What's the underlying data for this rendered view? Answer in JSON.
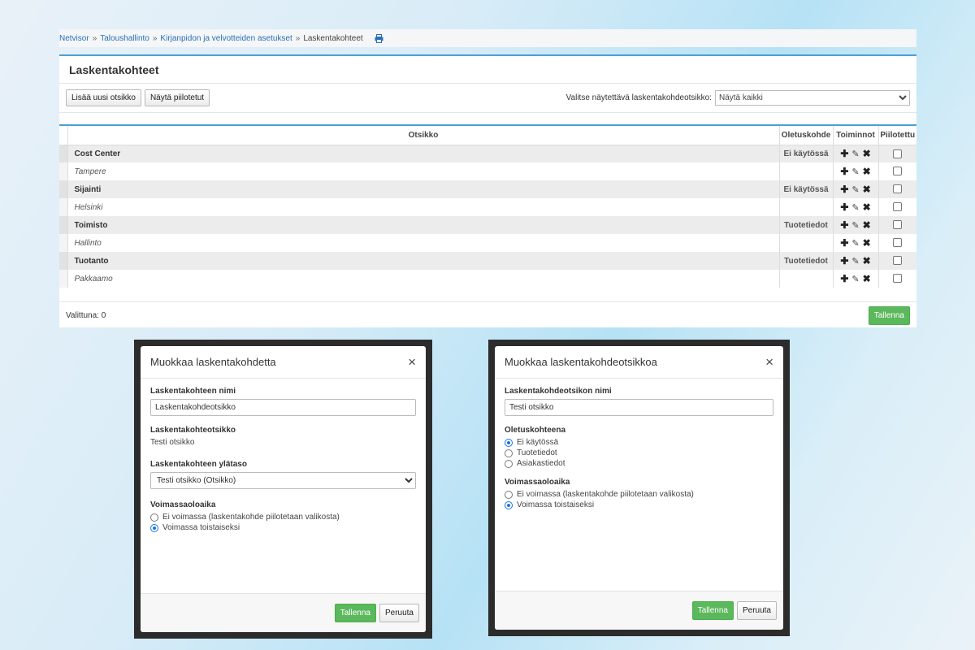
{
  "breadcrumb": [
    "Netvisor",
    "Taloushallinto",
    "Kirjanpidon ja velvotteiden asetukset",
    "Laskentakohteet"
  ],
  "breadcrumb_sep": "»",
  "page": {
    "title": "Laskentakohteet",
    "add_button": "Lisää uusi otsikko",
    "show_hidden_button": "Näytä piilotetut",
    "filter_label": "Valitse näytettävä laskentakohdeotsikko:",
    "filter_value": "Näytä kaikki"
  },
  "table": {
    "headers": [
      "Otsikko",
      "Oletuskohde",
      "Toiminnot",
      "Piilotettu"
    ],
    "rows": [
      {
        "name": "Cost Center",
        "default": "Ei käytössä",
        "type": "head"
      },
      {
        "name": "Tampere",
        "default": "",
        "type": "child"
      },
      {
        "name": "Sijainti",
        "default": "Ei käytössä",
        "type": "head"
      },
      {
        "name": "Helsinki",
        "default": "",
        "type": "child"
      },
      {
        "name": "Toimisto",
        "default": "Tuotetiedot",
        "type": "head"
      },
      {
        "name": "Hallinto",
        "default": "",
        "type": "child"
      },
      {
        "name": "Tuotanto",
        "default": "Tuotetiedot",
        "type": "head"
      },
      {
        "name": "Pakkaamo",
        "default": "",
        "type": "child"
      }
    ]
  },
  "footer": {
    "selected": "Valittuna: 0",
    "save": "Tallenna"
  },
  "modal_left": {
    "title": "Muokkaa laskentakohdetta",
    "close": "×",
    "name_label": "Laskentakohteen nimi",
    "name_value": "Laskentakohdeotsikko",
    "heading_label": "Laskentakohteotsikko",
    "heading_value": "Testi otsikko",
    "parent_label": "Laskentakohteen ylätaso",
    "parent_value": "Testi otsikko (Otsikko)",
    "validity_label": "Voimassaoloaika",
    "options": [
      "Ei voimassa (laskentakohde piilotetaan valikosta)",
      "Voimassa toistaiseksi"
    ],
    "selected": 1,
    "save": "Tallenna",
    "cancel": "Peruuta"
  },
  "modal_right": {
    "title": "Muokkaa laskentakohdeotsikkoa",
    "close": "×",
    "name_label": "Laskentakohdeotsikon nimi",
    "name_value": "Testi otsikko",
    "default_label": "Oletuskohteena",
    "default_options": [
      "Ei käytössä",
      "Tuotetiedot",
      "Asiakastiedot"
    ],
    "default_selected": 0,
    "validity_label": "Voimassaoloaika",
    "options": [
      "Ei voimassa (laskentakohde piilotetaan valikosta)",
      "Voimassa toistaiseksi"
    ],
    "selected": 1,
    "save": "Tallenna",
    "cancel": "Peruuta"
  },
  "colors": {
    "accent": "#4aa0d8",
    "save_green": "#5cb85c"
  }
}
